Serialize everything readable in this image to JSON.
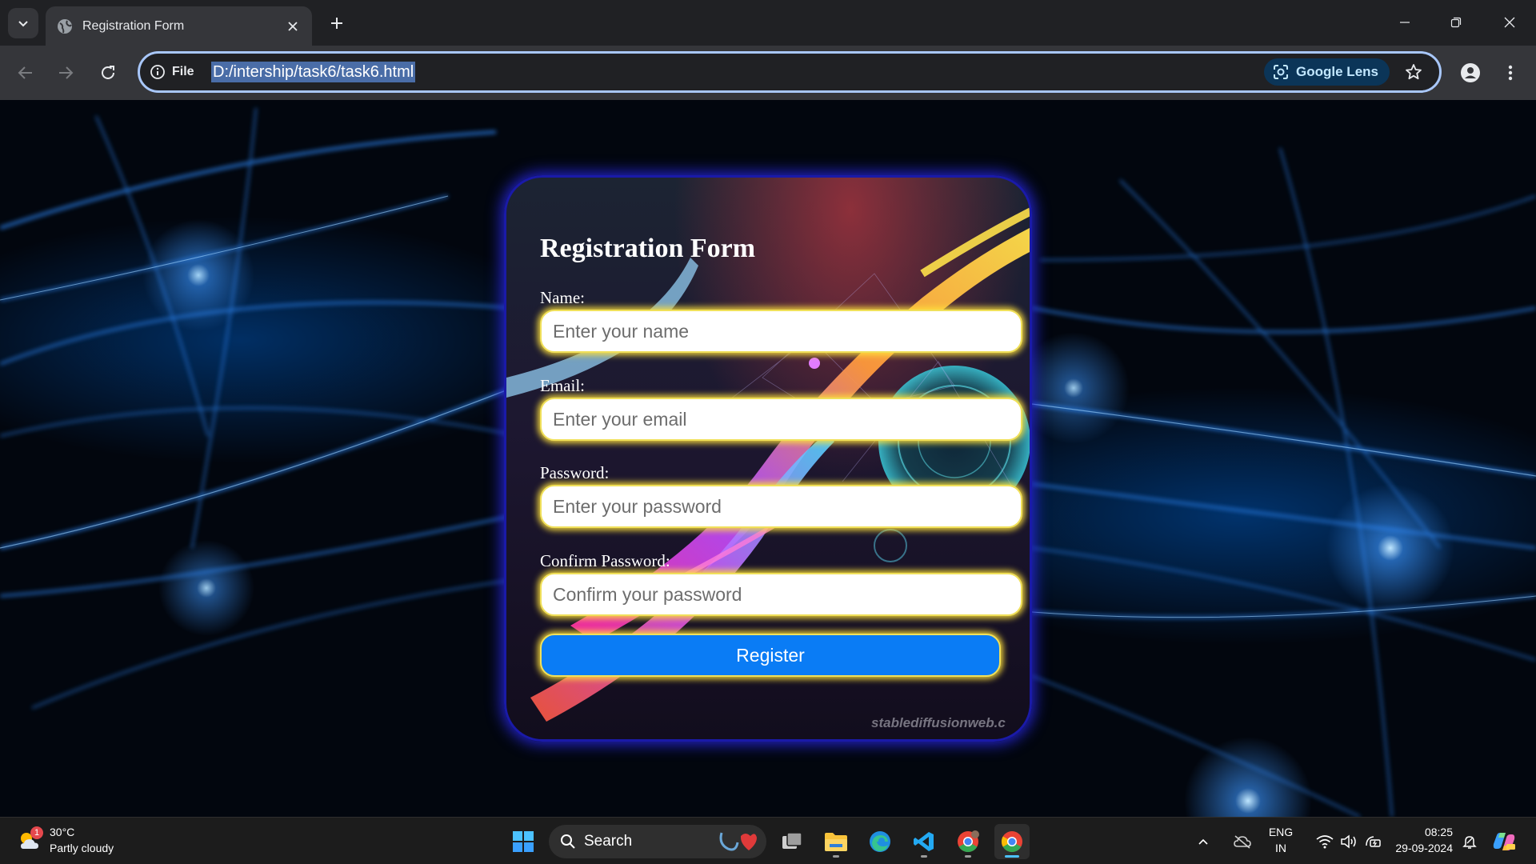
{
  "browser": {
    "tab": {
      "title": "Registration Form"
    },
    "address_bar": {
      "scheme_label": "File",
      "url": "D:/intership/task6/task6.html"
    },
    "lens_label": "Google Lens"
  },
  "form": {
    "title": "Registration Form",
    "fields": [
      {
        "label": "Name:",
        "placeholder": "Enter your name"
      },
      {
        "label": "Email:",
        "placeholder": "Enter your email"
      },
      {
        "label": "Password:",
        "placeholder": "Enter your password"
      },
      {
        "label": "Confirm Password:",
        "placeholder": "Confirm your password"
      }
    ],
    "submit_label": "Register",
    "watermark": "stablediffusionweb.c",
    "colors": {
      "button": "#0a7cf5",
      "input_glow": "#ffe13c",
      "card_border": "#1a1aa8"
    }
  },
  "taskbar": {
    "weather": {
      "temperature": "30°C",
      "condition": "Partly cloudy",
      "badge": "1"
    },
    "search_label": "Search",
    "language": {
      "line1": "ENG",
      "line2": "IN"
    },
    "clock": {
      "time": "08:25",
      "date": "29-09-2024"
    }
  }
}
